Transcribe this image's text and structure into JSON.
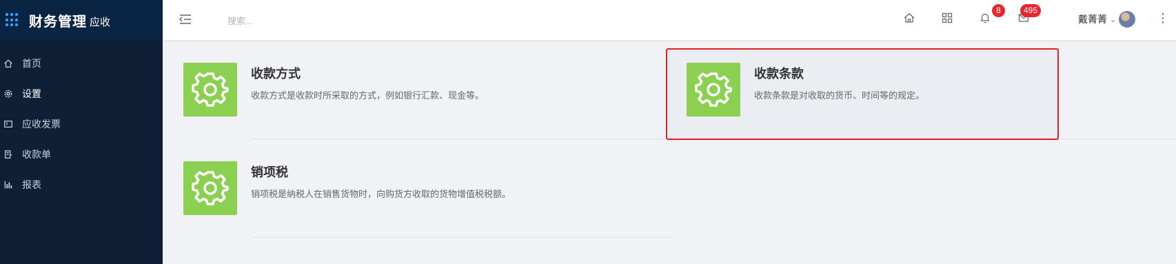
{
  "sidebar": {
    "brand_title": "财务管理",
    "brand_sub": "应收",
    "items": [
      {
        "label": "首页",
        "icon": "home-icon",
        "active": false
      },
      {
        "label": "设置",
        "icon": "gear-icon",
        "active": true
      },
      {
        "label": "应收发票",
        "icon": "invoice-icon",
        "active": false
      },
      {
        "label": "收款单",
        "icon": "receipt-icon",
        "active": false
      },
      {
        "label": "报表",
        "icon": "bar-chart-icon",
        "active": false
      }
    ]
  },
  "header": {
    "search_placeholder": "搜索...",
    "notifications_count": "8",
    "messages_count": "495",
    "user_name": "戴菁菁"
  },
  "cards": [
    {
      "title": "收款方式",
      "description": "收款方式是收款时所采取的方式，例如银行汇款、现金等。",
      "icon": "gear-icon"
    },
    {
      "title": "收款条款",
      "description": "收款条款是对收取的货币、时间等的规定。",
      "icon": "gear-icon",
      "highlighted": true
    },
    {
      "title": "销项税",
      "description": "销项税是纳税人在销售货物时，向购货方收取的货物增值税税额。",
      "icon": "gear-icon"
    }
  ],
  "colors": {
    "sidebar_bg": "#0f1f36",
    "accent_green": "#8bd051",
    "badge_red": "#e8262b",
    "highlight_border": "#e02020"
  }
}
